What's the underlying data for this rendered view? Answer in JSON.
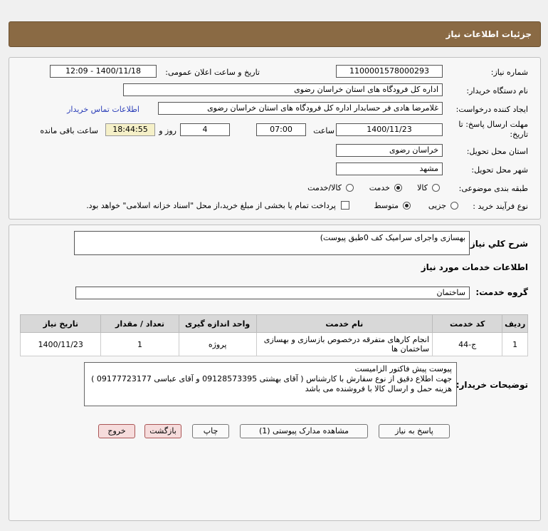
{
  "header": {
    "title": "جزئیات اطلاعات نیاز"
  },
  "fields": {
    "need_number_label": "شماره نیاز:",
    "need_number": "1100001578000293",
    "announce_label": "تاریخ و ساعت اعلان عمومی:",
    "announce_value": "1400/11/18 - 12:09",
    "buyer_org_label": "نام دستگاه خریدار:",
    "buyer_org": "اداره کل فرودگاه های استان خراسان رضوی",
    "creator_label": "ایجاد کننده درخواست:",
    "creator": "غلامرضا هادی فر حسابدار اداره کل فرودگاه های استان خراسان رضوی",
    "contact_link": "اطلاعات تماس خریدار",
    "deadline_label_1": "مهلت ارسال پاسخ: تا",
    "deadline_label_2": "تاریخ:",
    "deadline_date": "1400/11/23",
    "hour_label": "ساعت",
    "deadline_time": "07:00",
    "days_value": "4",
    "days_label": "روز و",
    "remaining_time": "18:44:55",
    "remaining_label": "ساعت باقی مانده",
    "province_label": "استان محل تحویل:",
    "province": "خراسان رضوی",
    "city_label": "شهر محل تحویل:",
    "city": "مشهد",
    "category_label": "طبقه بندی موضوعی:",
    "category_options": [
      "کالا",
      "خدمت",
      "کالا/خدمت"
    ],
    "category_selected": "خدمت",
    "process_label": "نوع فرآیند خرید :",
    "process_options": [
      "جزیی",
      "متوسط"
    ],
    "process_selected": "متوسط",
    "payment_note": "پرداخت تمام یا بخشی از مبلغ خرید،از محل \"اسناد خزانه اسلامی\" خواهد بود."
  },
  "summary": {
    "label": "شرح کلي نياز:",
    "value": "بهسازی واجرای سرامیک کف 0طبق پیوست)"
  },
  "services": {
    "section_title": "اطلاعات خدمات مورد نیاز",
    "group_label": "گروه خدمت:",
    "group_value": "ساختمان",
    "columns": [
      "ردیف",
      "کد خدمت",
      "نام خدمت",
      "واحد اندازه گیری",
      "تعداد / مقدار",
      "تاریخ نیاز"
    ],
    "rows": [
      {
        "row": "1",
        "code": "ج-44",
        "name": "انجام کارهای متفرقه درخصوص بازسازی و بهسازی ساختمان ها",
        "unit": "پروژه",
        "qty": "1",
        "date": "1400/11/23"
      }
    ]
  },
  "buyer_notes": {
    "label": "توضیحات خریدار:",
    "lines": [
      "پیوست پیش فاکتور الزامیست",
      "جهت اطلاع دقیق از نوع سفارش با کارشناس   ( آقای بهشتی 09128573395  و  آقای عباسی 09177723177 )",
      "هزینه حمل و ارسال کالا با فروشنده می باشد"
    ]
  },
  "buttons": {
    "reply": "پاسخ به نیاز",
    "attachments": "مشاهده مدارک پیوستی (1)",
    "print": "چاپ",
    "back": "بازگشت",
    "exit": "خروج"
  }
}
